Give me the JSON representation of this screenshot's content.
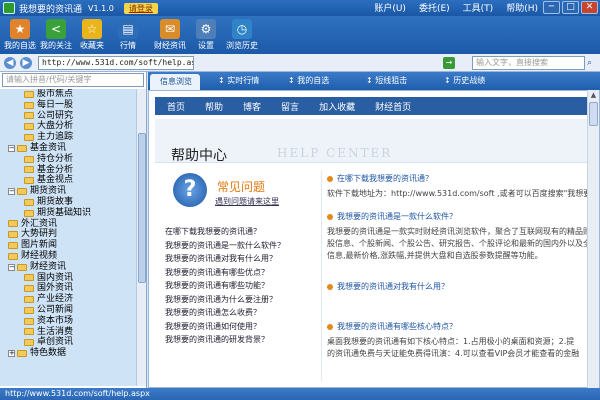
{
  "app": {
    "title": "我想要的资讯通",
    "version": "V1.1.0",
    "login": "请登录"
  },
  "menu": [
    "账户(U)",
    "委托(E)",
    "工具(T)",
    "帮助(H)"
  ],
  "window_buttons": {
    "min": "─",
    "max": "□",
    "close": "✕"
  },
  "toolbar": [
    {
      "label": "我的自选",
      "icon": "my-watchlist-icon",
      "color": "#e0832a"
    },
    {
      "label": "我的关注",
      "icon": "share-icon",
      "color": "#3aa03a"
    },
    {
      "label": "收藏夹",
      "icon": "star-icon",
      "color": "#e9b51a"
    },
    {
      "label": "行情",
      "icon": "market-icon",
      "color": "#2d6db8"
    },
    {
      "label": "财经资讯",
      "icon": "news-icon",
      "color": "#d98d2a"
    },
    {
      "label": "设置",
      "icon": "gear-icon",
      "color": "#4e7fb8"
    },
    {
      "label": "浏览历史",
      "icon": "history-icon",
      "color": "#2e84c6"
    }
  ],
  "address": {
    "url": "http://www.531d.com/soft/help.aspx",
    "search_placeholder": "输入文字，直接搜索"
  },
  "left": {
    "search_placeholder": "请输入拼音/代码/关键字",
    "tree": [
      {
        "label": "股市焦点",
        "level": 2
      },
      {
        "label": "每日一股",
        "level": 2
      },
      {
        "label": "公司研究",
        "level": 2
      },
      {
        "label": "大盘分析",
        "level": 2
      },
      {
        "label": "主力追踪",
        "level": 2
      },
      {
        "label": "基金资讯",
        "level": 1,
        "toggle": "−"
      },
      {
        "label": "持仓分析",
        "level": 2
      },
      {
        "label": "基金分析",
        "level": 2
      },
      {
        "label": "基金视点",
        "level": 2
      },
      {
        "label": "期货资讯",
        "level": 1,
        "toggle": "−"
      },
      {
        "label": "期货故事",
        "level": 2
      },
      {
        "label": "期货基础知识",
        "level": 2
      },
      {
        "label": "外汇资讯",
        "level": 1
      },
      {
        "label": "大势研判",
        "level": 1
      },
      {
        "label": "图片新闻",
        "level": 1
      },
      {
        "label": "财经视频",
        "level": 1
      },
      {
        "label": "财经资讯",
        "level": 1,
        "toggle": "−"
      },
      {
        "label": "国内资讯",
        "level": 2
      },
      {
        "label": "国外资讯",
        "level": 2
      },
      {
        "label": "产业经济",
        "level": 2
      },
      {
        "label": "公司新闻",
        "level": 2
      },
      {
        "label": "资本市场",
        "level": 2
      },
      {
        "label": "生活消费",
        "level": 2
      },
      {
        "label": "卓创资讯",
        "level": 2
      },
      {
        "label": "特色数据",
        "level": 1,
        "toggle": "+"
      }
    ]
  },
  "tabs": [
    "信息浏览",
    "实时行情",
    "我的自选",
    "短线狙击",
    "历史战绩"
  ],
  "site_nav": [
    "首页",
    "帮助",
    "博客",
    "留言",
    "加入收藏",
    "财经首页"
  ],
  "help": {
    "title": "帮助中心",
    "bg_text": "HELP CENTER",
    "faq_title": "常见问题",
    "faq_sub": "遇到问题请来这里",
    "faq_list": [
      "在哪下载我想要的资讯通？",
      "我想要的资讯通是一款什么软件？",
      "我想要的资讯通对我有什么用？",
      "我想要的资讯通有哪些优点？",
      "我想要的资讯通有哪些功能？",
      "我想要的资讯通为什么要注册？",
      "我想要的资讯通怎么收费？",
      "我想要的资讯通如何使用？",
      "我想要的资讯通的研发背景？"
    ],
    "sections": [
      {
        "q": "在哪下载我想要的资讯通？",
        "a": [
          "软件下载地址为：http://www.531d.com/soft ,或者可以百度搜索\"我想要"
        ]
      },
      {
        "q": "我想要的资讯通是一款什么软件？",
        "a": [
          "我想要的资讯通是一款实时财经资讯浏览软件，聚合了互联网现有的精品财",
          "股信息、个股新闻、个股公告、研究报告、个股评论和最新的国内外以及全",
          "信息,最新价格,涨跌幅,并提供大盘和自选股参数提醒等功能。"
        ]
      },
      {
        "q": "我想要的资讯通对我有什么用？",
        "a": []
      },
      {
        "q": "我想要的资讯通有哪些核心特点？",
        "a": [
          "桌面我想要的资讯通有如下核心特点：1.占用极小的桌面和资源；2.提",
          "的资讯通免费与天证能免费得讯演：4.可以查看VIP会员才能查看的金融"
        ]
      }
    ]
  },
  "status": "http://www.531d.com/soft/help.aspx"
}
